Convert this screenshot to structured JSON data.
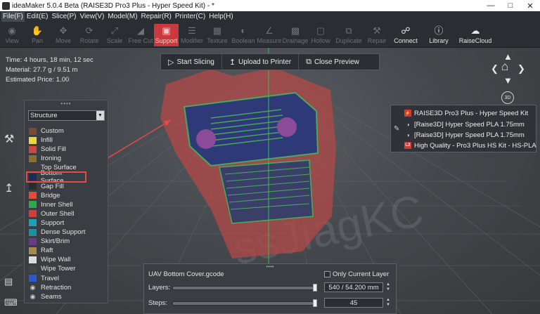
{
  "window": {
    "title": "ideaMaker 5.0.4 Beta (RAISE3D Pro3 Plus - Hyper Speed Kit) - *",
    "minimize_icon": "minimize-icon",
    "maximize_icon": "maximize-icon",
    "close_icon": "close-icon"
  },
  "menu": [
    "File(F)",
    "Edit(E)",
    "Slice(P)",
    "View(V)",
    "Model(M)",
    "Repair(R)",
    "Printer(C)",
    "Help(H)"
  ],
  "toolbar": {
    "view": "View",
    "pan": "Pan",
    "move": "Move",
    "rotate": "Rotate",
    "scale": "Scale",
    "free_cut": "Free Cut",
    "support": "Support",
    "modifier": "Modifier",
    "texture": "Texture",
    "boolean": "Boolean",
    "measure": "Measure",
    "drainage": "Drainage",
    "hollow": "Hollow",
    "duplicate": "Duplicate",
    "repair": "Repair",
    "connect": "Connect",
    "library": "Library",
    "raisecloud": "RaiseCloud"
  },
  "info": {
    "time": "Time: 4 hours, 18 min, 12 sec",
    "material": "Material: 27.7 g / 9.51 m",
    "price": "Estimated Price: 1.00"
  },
  "slice_bar": {
    "start": "Start Slicing",
    "upload": "Upload to Printer",
    "close": "Close Preview"
  },
  "legend": {
    "selected": "Structure",
    "items": [
      {
        "label": "Custom",
        "color": "#7a4a38"
      },
      {
        "label": "Infill",
        "color": "#e9d83a"
      },
      {
        "label": "Solid Fill",
        "color": "#d0463f"
      },
      {
        "label": "Ironing",
        "color": "#8b6f2a"
      },
      {
        "label": "Top Surface",
        "color": "#3a3d41"
      },
      {
        "label": "Bottom Surface",
        "color": "#1f2a55"
      },
      {
        "label": "Gap Fill",
        "color": "#2b2b2b"
      },
      {
        "label": "Bridge",
        "color": "#e84a3a"
      },
      {
        "label": "Inner Shell",
        "color": "#2fa84a"
      },
      {
        "label": "Outer Shell",
        "color": "#d83a3a"
      },
      {
        "label": "Support",
        "color": "#1ea0b8"
      },
      {
        "label": "Dense Support",
        "color": "#1e8fa0"
      },
      {
        "label": "Skirt/Brim",
        "color": "#6a3a8c"
      },
      {
        "label": "Raft",
        "color": "#a88a4a"
      },
      {
        "label": "Wipe Wall",
        "color": "#dcdcdc"
      },
      {
        "label": "Wipe Tower",
        "color": "#444444"
      },
      {
        "label": "Travel",
        "color": "#2a5ad0"
      },
      {
        "label": "Retraction",
        "color": "eye"
      },
      {
        "label": "Seams",
        "color": "eye"
      }
    ]
  },
  "profile": {
    "printer": "RAISE3D Pro3 Plus - Hyper Speed Kit",
    "filament1": "[Raise3D] Hyper Speed PLA 1.75mm",
    "filament2": "[Raise3D] Hyper Speed PLA 1.75mm",
    "badge": "L2",
    "quality": "High Quality - Pro3 Plus HS Kit - HS-PLA"
  },
  "gcode_panel": {
    "filename": "UAV Bottom Cover.gcode",
    "only_current_layer": "Only Current Layer",
    "layers_label": "Layers:",
    "layers_value": "540 / 54.200 mm",
    "steps_label": "Steps:",
    "steps_value": "45"
  }
}
